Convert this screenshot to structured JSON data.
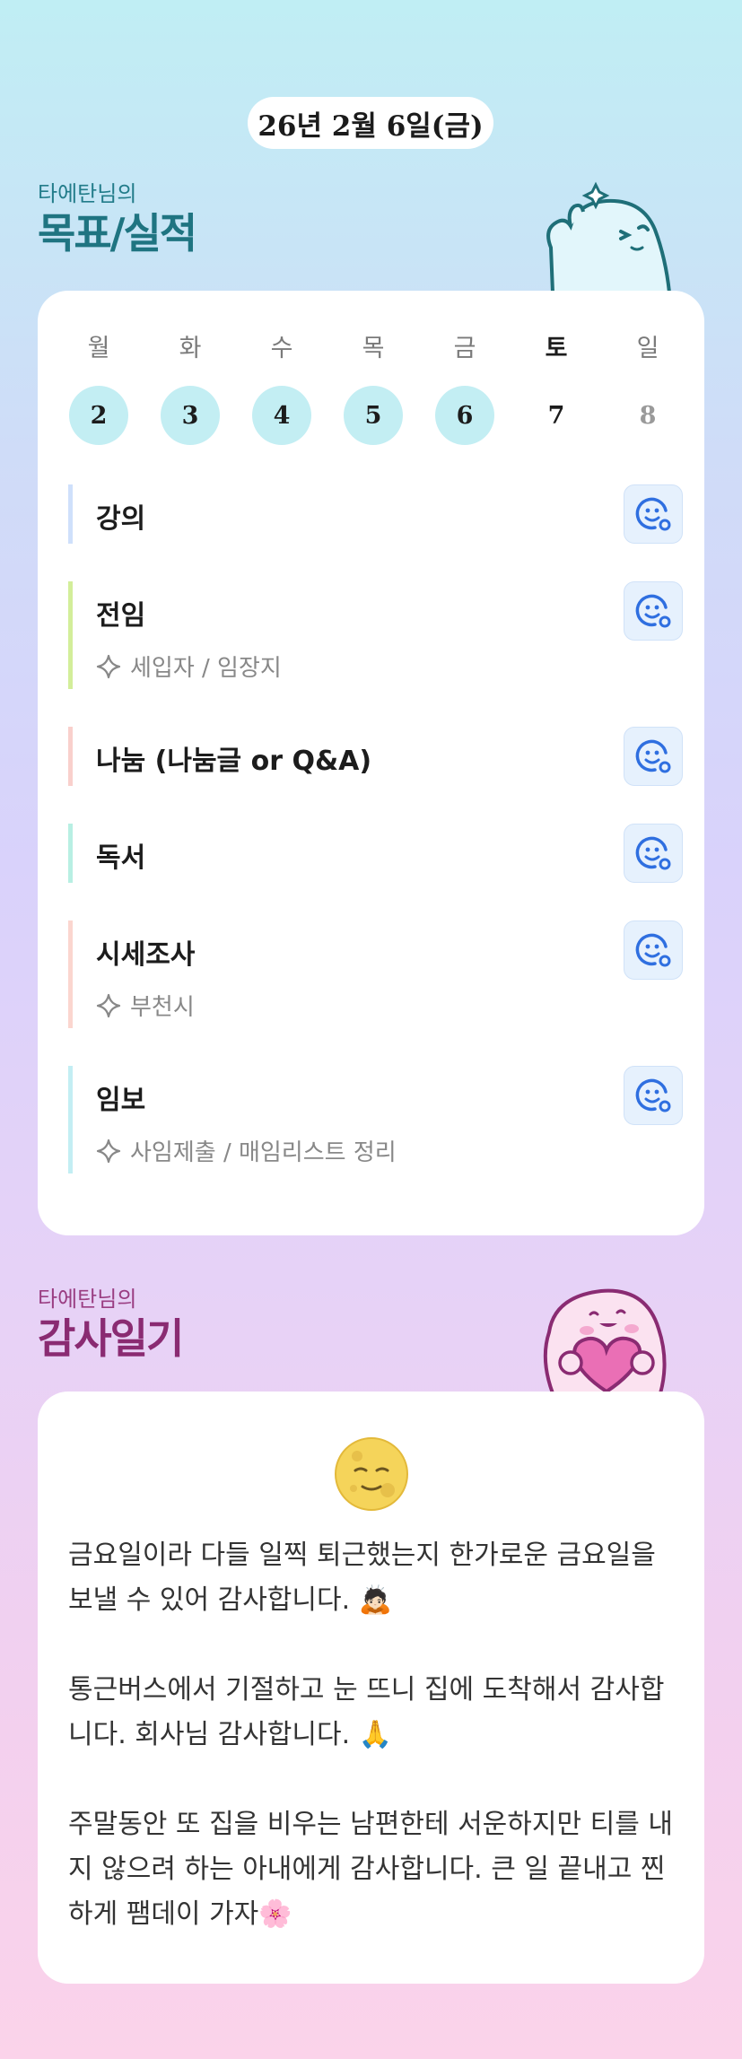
{
  "header": {
    "date": "26년 2월 6일(금)"
  },
  "goals_section": {
    "subtitle": "타에탄님의",
    "title": "목표/실적",
    "week": {
      "day_names": [
        "월",
        "화",
        "수",
        "목",
        "금",
        "토",
        "일"
      ],
      "dates": [
        "2",
        "3",
        "4",
        "5",
        "6",
        "7",
        "8"
      ],
      "done": [
        true,
        true,
        true,
        true,
        true,
        false,
        false
      ],
      "today_index": 5
    },
    "goals": [
      {
        "title": "강의",
        "sub": "",
        "color": "#cfe0fb",
        "icon": "smile-icon"
      },
      {
        "title": "전임",
        "sub": "세입자 / 임장지",
        "color": "#d3ee9a",
        "icon": "smile-icon"
      },
      {
        "title": "나눔 (나눔글 or Q&A)",
        "sub": "",
        "color": "#f9d0cc",
        "icon": "smile-icon"
      },
      {
        "title": "독서",
        "sub": "",
        "color": "#b8efe3",
        "icon": "smile-icon"
      },
      {
        "title": "시세조사",
        "sub": "부천시",
        "color": "#fbd6cf",
        "icon": "smile-icon"
      },
      {
        "title": "임보",
        "sub": "사임제출 / 매임리스트 정리",
        "color": "#c3eef3",
        "icon": "smile-icon"
      }
    ]
  },
  "diary_section": {
    "subtitle": "타에탄님의",
    "title": "감사일기",
    "mood_icon": "full-moon-face-icon",
    "entries": [
      "금요일이라 다들 일찍 퇴근했는지 한가로운 금요일을 보낼 수 있어 감사합니다. 🙇🏻",
      "통근버스에서 기절하고 눈 뜨니 집에 도착해서 감사합니다. 회사님 감사합니다. 🙏",
      "주말동안 또 집을 비우는 남편한테 서운하지만 티를 내지 않으려 하는 아내에게 감사합니다. 큰 일 끝내고 찐하게 팸데이 가자🌸"
    ]
  },
  "colors": {
    "accent_teal": "#1f7481",
    "accent_plum": "#8a2b72",
    "done_circle": "#c3eef3",
    "icon_blue": "#2f6fe0"
  }
}
